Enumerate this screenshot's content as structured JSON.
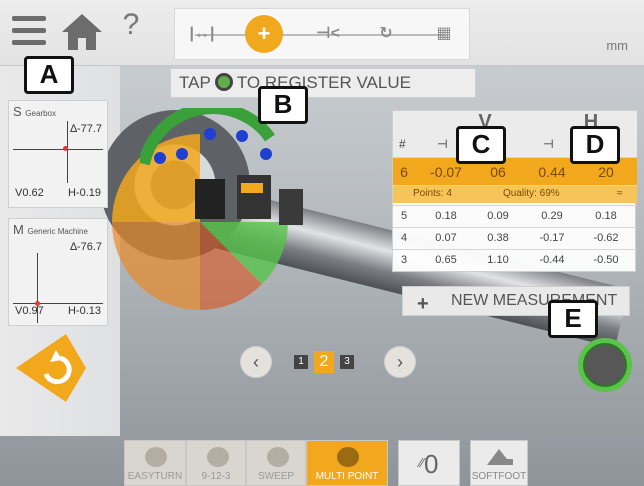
{
  "toolbar": {
    "help": "?",
    "unit": "mm",
    "steps": [
      "|↔|",
      "+",
      "⊣<",
      "↻",
      "▦"
    ]
  },
  "banner": {
    "text_before": "TAP",
    "text_after": "TO REGISTER VALUE"
  },
  "readout_s": {
    "prefix": "S",
    "name": "Gearbox",
    "angle": "∆-77.7",
    "v": "V0.62",
    "h": "H-0.19"
  },
  "readout_m": {
    "prefix": "M",
    "name": "Generic Machine",
    "angle": "∆-76.7",
    "v": "V0.97",
    "h": "H-0.13"
  },
  "table": {
    "col_v": "V",
    "col_h": "H",
    "hash": "#",
    "highlight": {
      "n": "6",
      "v1": "-0.07",
      "v2": "06",
      "h1": "0.44",
      "h2": "20"
    },
    "points": "Points: 4",
    "quality": "Quality: 69%",
    "rows": [
      {
        "n": "5",
        "v1": "0.18",
        "v2": "0.09",
        "h1": "0.29",
        "h2": "0.18"
      },
      {
        "n": "4",
        "v1": "0.07",
        "v2": "0.38",
        "h1": "-0.17",
        "h2": "-0.62"
      },
      {
        "n": "3",
        "v1": "0.65",
        "v2": "1.10",
        "h1": "-0.44",
        "h2": "-0.50"
      }
    ]
  },
  "new_measurement": "NEW MEASUREMENT",
  "pager": {
    "prev": "‹",
    "next": "›",
    "pages": [
      "1",
      "2",
      "3"
    ],
    "current": "2"
  },
  "modes": [
    "EASYTURN",
    "9-12-3",
    "SWEEP",
    "MULTI POINT"
  ],
  "counter": "0",
  "softfoot": "SOFTFOOT",
  "callouts": [
    "A",
    "B",
    "C",
    "D",
    "E"
  ],
  "colors": {
    "accent": "#f2a81d",
    "register": "#59c34a"
  }
}
